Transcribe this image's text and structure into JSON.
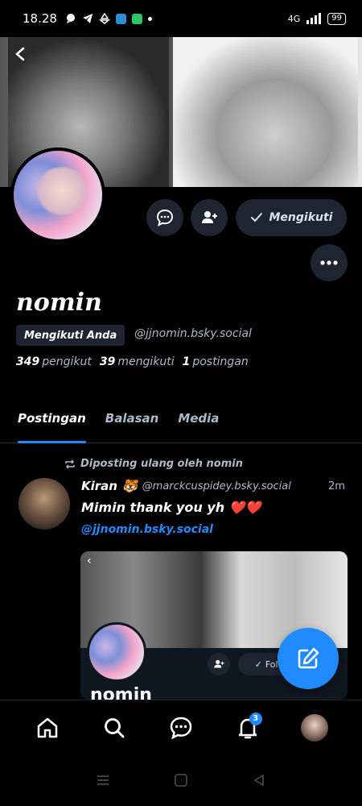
{
  "status_bar": {
    "time": "18.28",
    "network": "4G",
    "battery": "99"
  },
  "profile": {
    "display_name": "nomin",
    "follows_you_label": "Mengikuti Anda",
    "handle": "@jjnomin.bsky.social",
    "following_button_label": "Mengikuti",
    "stats": {
      "followers_count": "349",
      "followers_label": "pengikut",
      "following_count": "39",
      "following_label": "mengikuti",
      "posts_count": "1",
      "posts_label": "postingan"
    }
  },
  "tabs": [
    {
      "label": "Postingan",
      "active": true
    },
    {
      "label": "Balasan",
      "active": false
    },
    {
      "label": "Media",
      "active": false
    }
  ],
  "post": {
    "repost_label": "Diposting ulang oleh nomin",
    "author_name": "Kiran",
    "author_emoji": "🐯",
    "author_handle": "@marckcuspidey.bsky.social",
    "time": "2m",
    "text": "Mimin thank you yh ❤️❤️",
    "mention": "@jjnomin.bsky.social",
    "embed": {
      "display_name": "nomin",
      "follow_label": "Follo"
    }
  },
  "bottom_nav": {
    "notification_count": "3"
  },
  "colors": {
    "accent": "#208bfe",
    "button_bg": "#1e2531",
    "muted_text": "#aeb9c8"
  }
}
